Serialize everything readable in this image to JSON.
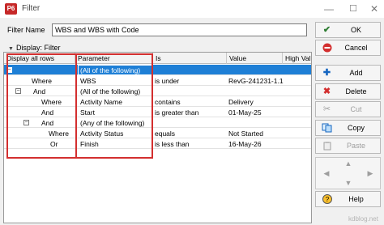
{
  "window": {
    "app_icon": "P6",
    "title": "Filter",
    "controls": [
      "—",
      "☐",
      "✕"
    ]
  },
  "filter_name": {
    "label": "Filter Name",
    "value": "WBS and WBS with Code"
  },
  "display_header": "Display: Filter",
  "grid": {
    "columns": [
      "Display all rows",
      "Parameter",
      "Is",
      "Value",
      "High Value"
    ],
    "rows": [
      {
        "col1": "",
        "param": "(All of the following)",
        "is": "",
        "value": "",
        "high": ""
      },
      {
        "col1": "Where",
        "param": "WBS",
        "is": "is under",
        "value": "RevG-241231-1.1",
        "high": ""
      },
      {
        "col1": "And",
        "param": "(All of the following)",
        "is": "",
        "value": "",
        "high": ""
      },
      {
        "col1": "Where",
        "param": "Activity Name",
        "is": "contains",
        "value": "Delivery",
        "high": ""
      },
      {
        "col1": "And",
        "param": "Start",
        "is": "is greater than",
        "value": "01-May-25",
        "high": ""
      },
      {
        "col1": "And",
        "param": "(Any of the following)",
        "is": "",
        "value": "",
        "high": ""
      },
      {
        "col1": "Where",
        "param": "Activity Status",
        "is": "equals",
        "value": "Not Started",
        "high": ""
      },
      {
        "col1": "Or",
        "param": "Finish",
        "is": "is less than",
        "value": "16-May-26",
        "high": ""
      }
    ],
    "tree_toggle": "−"
  },
  "buttons": {
    "ok": "OK",
    "cancel": "Cancel",
    "add": "Add",
    "delete": "Delete",
    "cut": "Cut",
    "copy": "Copy",
    "paste": "Paste",
    "help": "Help"
  },
  "icons": {
    "ok": "check-icon",
    "cancel": "no-entry-icon",
    "add": "plus-icon",
    "delete": "x-icon",
    "cut": "scissors-icon",
    "copy": "copy-icon",
    "paste": "paste-icon",
    "help": "help-icon"
  },
  "colors": {
    "selection": "#1e7fd6",
    "highlight_box": "#d32f2f",
    "ok_icon": "#2e7d32",
    "cancel_icon": "#d32f2f",
    "add_icon": "#1565c0",
    "delete_icon": "#d32f2f"
  },
  "watermark": "kdblog.net"
}
